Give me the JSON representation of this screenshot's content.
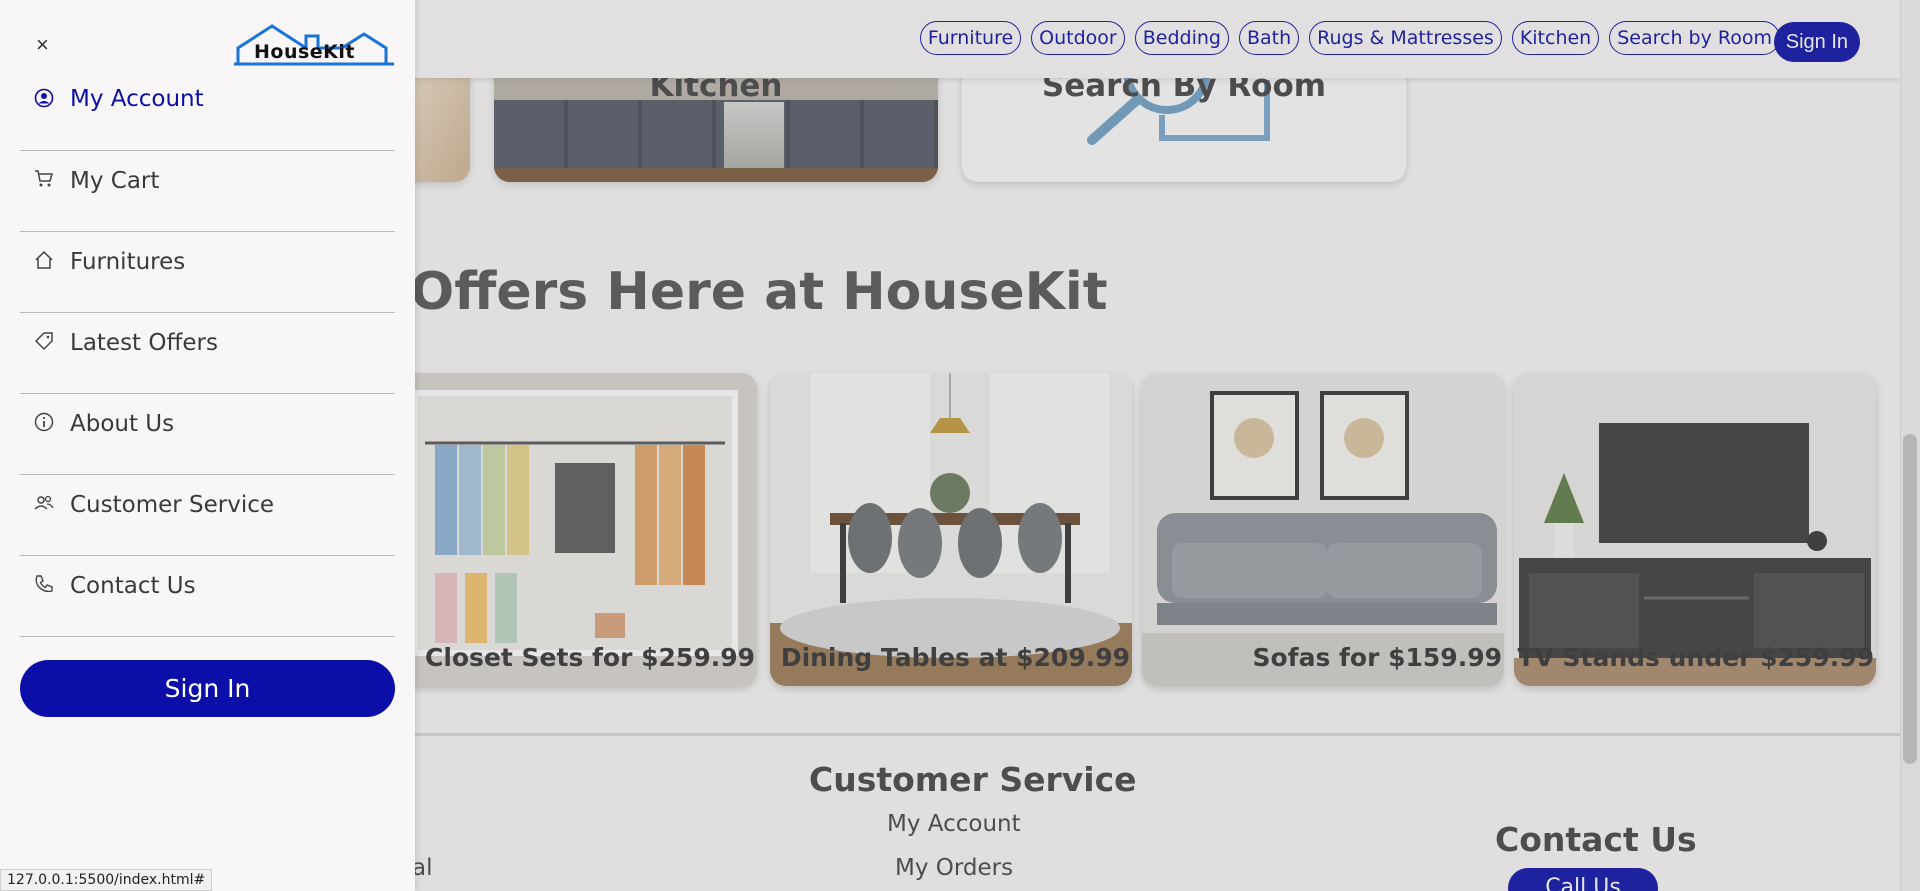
{
  "nav": {
    "links": [
      "Furniture",
      "Outdoor",
      "Bedding",
      "Bath",
      "Rugs & Mattresses",
      "Kitchen",
      "Search by Room"
    ],
    "signin_label": "Sign In"
  },
  "categories": {
    "kitchen_label": "Kitchen",
    "room_label": "Search By Room"
  },
  "offers": {
    "title": "Offers Here at HouseKit",
    "items": [
      {
        "caption": "Closet Sets for $259.99"
      },
      {
        "caption": "Dining Tables at $209.99"
      },
      {
        "caption": "Sofas for $159.99"
      },
      {
        "caption": "TV Stands under $259.99"
      }
    ]
  },
  "footer": {
    "customer_service_heading": "Customer Service",
    "customer_service_links": [
      "My Account",
      "My Orders"
    ],
    "contact_heading": "Contact Us",
    "call_label": "Call Us",
    "partial_text": "al"
  },
  "drawer": {
    "close_label": "×",
    "logo_text": "HouseKit",
    "menu": [
      {
        "label": "My Account",
        "icon": "user-circle-icon",
        "active": true
      },
      {
        "label": "My Cart",
        "icon": "cart-icon"
      },
      {
        "label": "Furnitures",
        "icon": "home-icon"
      },
      {
        "label": "Latest Offers",
        "icon": "tag-icon"
      },
      {
        "label": "About Us",
        "icon": "info-icon"
      },
      {
        "label": "Customer Service",
        "icon": "users-icon"
      },
      {
        "label": "Contact Us",
        "icon": "phone-icon"
      }
    ],
    "signin_label": "Sign In"
  },
  "status_bar": {
    "url": "127.0.0.1:5500/index.html#"
  },
  "colors": {
    "brand": "#0b0fa8",
    "background": "#f7f5f5",
    "logo_blue": "#1a73d9"
  }
}
